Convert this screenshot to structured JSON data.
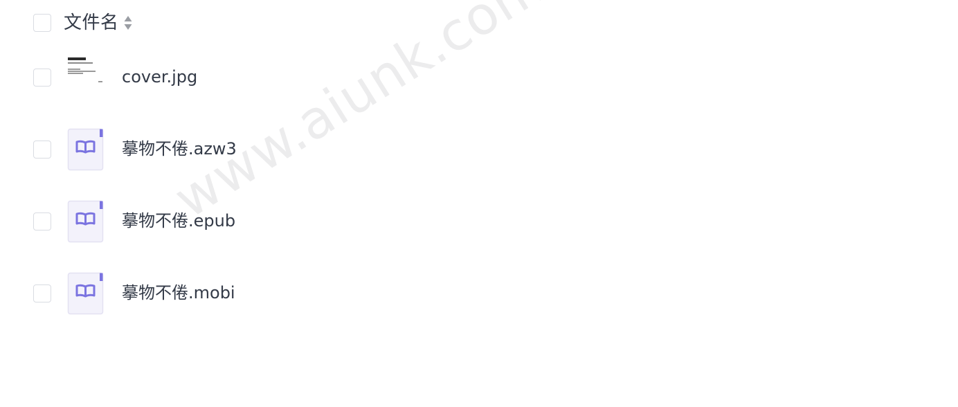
{
  "header": {
    "label": "文件名",
    "sort_icon": "sort-icon"
  },
  "files": [
    {
      "name": "cover.jpg",
      "icon": "image-thumbnail"
    },
    {
      "name": "摹物不倦.azw3",
      "icon": "book-icon"
    },
    {
      "name": "摹物不倦.epub",
      "icon": "book-icon"
    },
    {
      "name": "摹物不倦.mobi",
      "icon": "book-icon"
    }
  ],
  "watermark": "www.aiunk.com",
  "colors": {
    "text": "#333a47",
    "checkbox_border": "#d9dce2",
    "book_icon": "#7b74e0",
    "book_bg": "#f3f2fb",
    "book_border": "#e3e1f2",
    "sort_icon": "#9a9da3"
  }
}
